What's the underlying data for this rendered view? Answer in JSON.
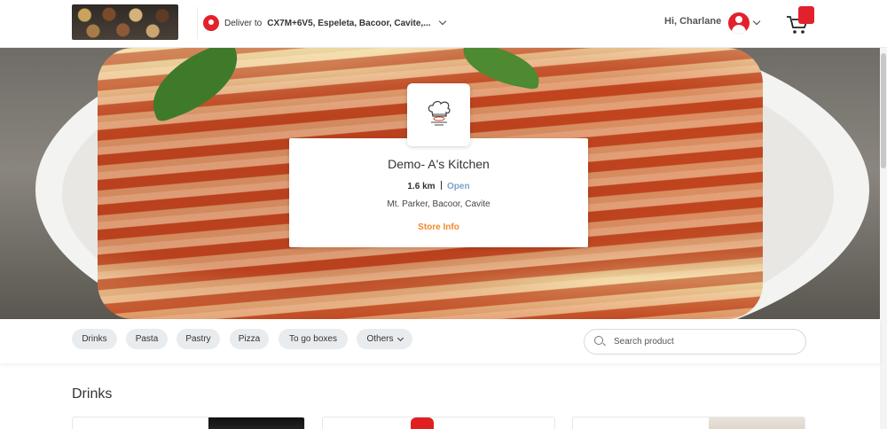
{
  "header": {
    "deliver_prefix": "Deliver to",
    "deliver_address": "CX7M+6V5, Espeleta, Bacoor, Cavite,...",
    "greeting": "Hi, Charlane"
  },
  "store": {
    "name": "Demo- A's Kitchen",
    "distance": "1.6 km",
    "status": "Open",
    "address": "Mt. Parker, Bacoor, Cavite",
    "info_link": "Store Info"
  },
  "categories": {
    "items": [
      {
        "label": "Drinks"
      },
      {
        "label": "Pasta"
      },
      {
        "label": "Pastry"
      },
      {
        "label": "Pizza"
      },
      {
        "label": "To go boxes"
      }
    ],
    "more_label": "Others"
  },
  "search": {
    "placeholder": "Search product"
  },
  "section": {
    "title": "Drinks"
  },
  "colors": {
    "accent_red": "#e3212b",
    "store_info_orange": "#f08a2b",
    "status_blue": "#7ba1c9"
  }
}
